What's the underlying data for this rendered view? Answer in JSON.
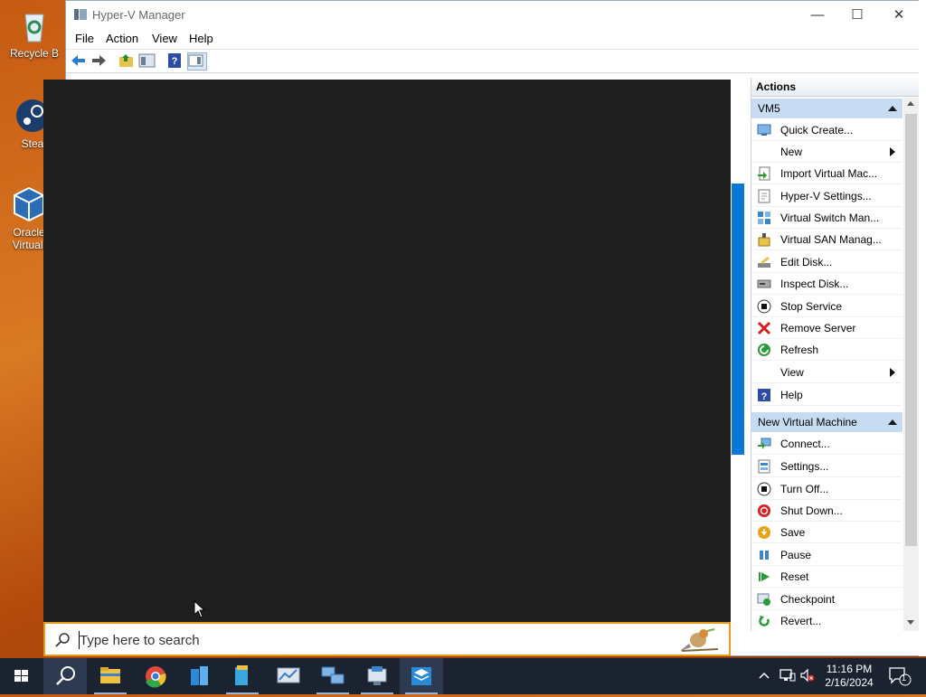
{
  "desktop": {
    "icons": [
      {
        "label": "Recycle B",
        "icon": "recycle-bin-icon"
      },
      {
        "label": "Stea",
        "icon": "steam-icon"
      },
      {
        "label": "Oracle Virtuall",
        "icon": "virtualbox-icon"
      }
    ]
  },
  "window": {
    "title": "Hyper-V Manager",
    "menu": [
      "File",
      "Action",
      "View",
      "Help"
    ],
    "toolbar": [
      "back-icon",
      "forward-icon",
      "up-folder-icon",
      "show-hide-tree-icon",
      "help-icon",
      "show-hide-action-pane-icon"
    ]
  },
  "actions": {
    "header": "Actions",
    "groups": [
      {
        "title": "VM5",
        "items": [
          {
            "label": "Quick Create...",
            "icon": "quick-create-icon",
            "submenu": false
          },
          {
            "label": "New",
            "icon": "",
            "submenu": true
          },
          {
            "label": "Import Virtual Mac...",
            "icon": "import-icon",
            "submenu": false
          },
          {
            "label": "Hyper-V Settings...",
            "icon": "settings-page-icon",
            "submenu": false
          },
          {
            "label": "Virtual Switch Man...",
            "icon": "switch-icon",
            "submenu": false
          },
          {
            "label": "Virtual SAN Manag...",
            "icon": "san-icon",
            "submenu": false
          },
          {
            "label": "Edit Disk...",
            "icon": "edit-disk-icon",
            "submenu": false
          },
          {
            "label": "Inspect Disk...",
            "icon": "inspect-disk-icon",
            "submenu": false
          },
          {
            "label": "Stop Service",
            "icon": "stop-icon",
            "submenu": false
          },
          {
            "label": "Remove Server",
            "icon": "remove-x-icon",
            "submenu": false
          },
          {
            "label": "Refresh",
            "icon": "refresh-icon",
            "submenu": false
          },
          {
            "label": "View",
            "icon": "",
            "submenu": true
          },
          {
            "label": "Help",
            "icon": "help-icon",
            "submenu": false
          }
        ]
      },
      {
        "title": "New Virtual Machine",
        "items": [
          {
            "label": "Connect...",
            "icon": "connect-icon",
            "submenu": false
          },
          {
            "label": "Settings...",
            "icon": "settings-icon",
            "submenu": false
          },
          {
            "label": "Turn Off...",
            "icon": "turn-off-icon",
            "submenu": false
          },
          {
            "label": "Shut Down...",
            "icon": "shutdown-icon",
            "submenu": false
          },
          {
            "label": "Save",
            "icon": "save-icon",
            "submenu": false
          },
          {
            "label": "Pause",
            "icon": "pause-icon",
            "submenu": false
          },
          {
            "label": "Reset",
            "icon": "reset-icon",
            "submenu": false
          },
          {
            "label": "Checkpoint",
            "icon": "checkpoint-icon",
            "submenu": false
          },
          {
            "label": "Revert...",
            "icon": "revert-icon",
            "submenu": false
          }
        ]
      }
    ]
  },
  "search": {
    "placeholder": "Type here to search"
  },
  "taskbar": {
    "apps": [
      "start-icon",
      "search-icon",
      "file-explorer-icon",
      "chrome-icon",
      "azure-stack-icon",
      "server-manager-icon",
      "performance-monitor-icon",
      "network-icon",
      "hyper-v-icon",
      "virtualbox-icon"
    ],
    "time": "11:16 PM",
    "date": "2/16/2024",
    "notification_count": "1"
  },
  "colors": {
    "search_border": "#e59b1b",
    "group_header": "#c7dcf2",
    "taskbar": "#1b2230"
  }
}
